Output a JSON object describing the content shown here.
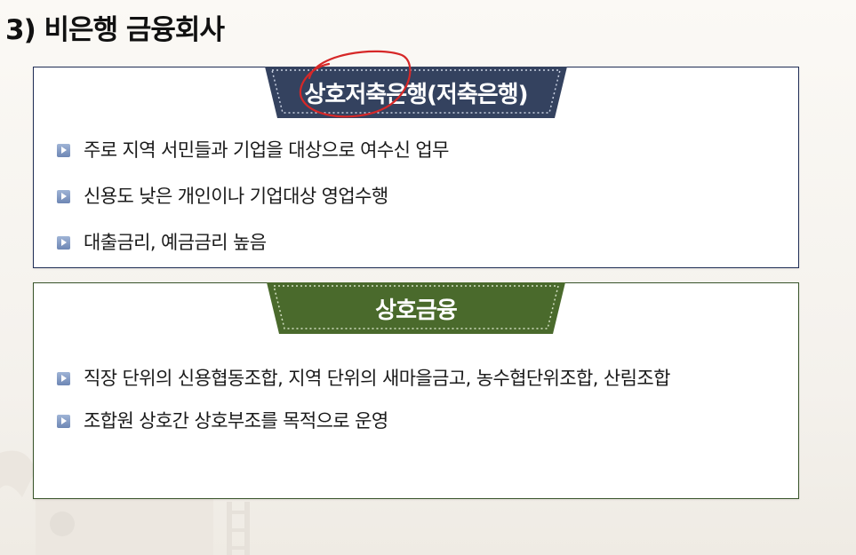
{
  "title": "3) 비은행 금융회사",
  "sections": [
    {
      "heading": "상호저축은행(저축은행)",
      "bullets": [
        "주로 지역 서민들과 기업을 대상으로 여수신 업무",
        "신용도 낮은 개인이나 기업대상 영업수행",
        "대출금리, 예금금리 높음"
      ]
    },
    {
      "heading": "상호금융",
      "bullets": [
        "직장 단위의  신용협동조합, 지역 단위의 새마을금고, 농수협단위조합, 산림조합",
        "조합원 상호간 상호부조를 목적으로 운영"
      ]
    }
  ],
  "colors": {
    "navy_banner": "#34425f",
    "green_banner": "#4a6a2c",
    "annotation": "#d62828"
  },
  "icons": {
    "bullet": "blue-square-arrow-icon"
  }
}
